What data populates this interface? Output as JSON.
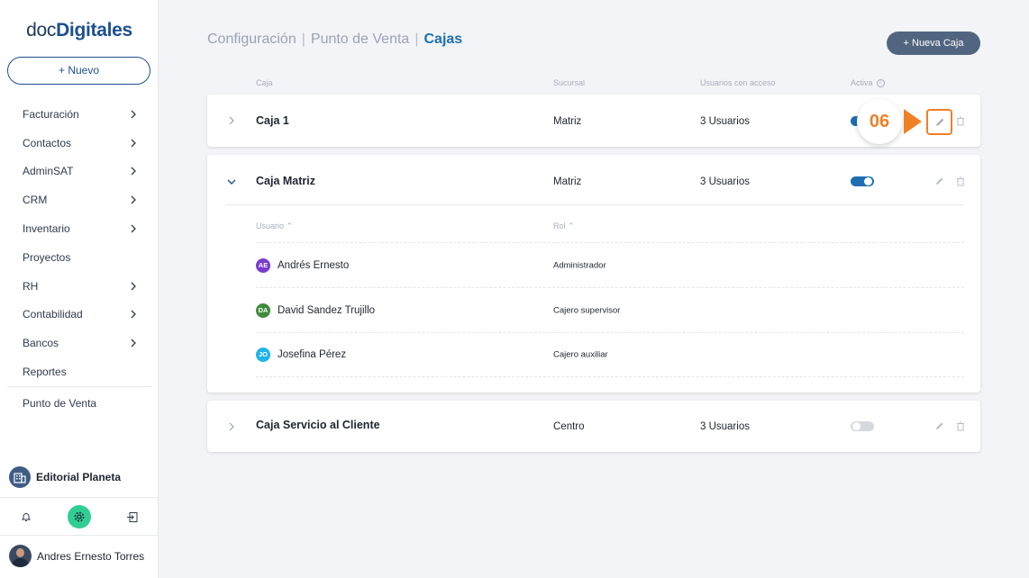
{
  "brand": {
    "logo_prefix": "doc",
    "logo_bold": "Digitales"
  },
  "sidebar": {
    "new_button": "+ Nuevo",
    "items": [
      {
        "label": "Facturación"
      },
      {
        "label": "Contactos"
      },
      {
        "label": "AdminSAT"
      },
      {
        "label": "CRM"
      },
      {
        "label": "Inventario"
      },
      {
        "label": "Proyectos"
      },
      {
        "label": "RH"
      },
      {
        "label": "Contabilidad"
      },
      {
        "label": "Bancos"
      },
      {
        "label": "Reportes"
      }
    ],
    "punto_venta": "Punto de Venta",
    "company": "Editorial Planeta",
    "user": "Andres Ernesto Torres",
    "icons": [
      "bell-icon",
      "gear-icon",
      "logout-icon"
    ],
    "gear_color": "#2fcf94"
  },
  "breadcrumb": {
    "part1": "Configuración",
    "part2": "Punto de Venta",
    "current": "Cajas",
    "separator": "|"
  },
  "nueva_caja_button": "+ Nueva Caja",
  "table": {
    "headers": {
      "caja": "Caja",
      "sucursal": "Sucursal",
      "usuarios": "Usuarios con acceso",
      "activa": "Activa"
    },
    "rows": [
      {
        "name": "Caja 1",
        "sucursal": "Matriz",
        "usuarios": "3 Usuarios",
        "active": true
      },
      {
        "name": "Caja Matriz",
        "sucursal": "Matriz",
        "usuarios": "3 Usuarios",
        "active": true,
        "expanded": true,
        "sub_headers": {
          "usuario": "Usuario ⌃",
          "rol": "Rol ⌃"
        },
        "members": [
          {
            "initials": "AE",
            "name": "Andrés Ernesto",
            "role": "Administrador",
            "color": "#7a3bd1"
          },
          {
            "initials": "DA",
            "name": "David Sandez Trujillo",
            "role": "Cajero supervisor",
            "color": "#3d8b3d"
          },
          {
            "initials": "JO",
            "name": "Josefina Pérez",
            "role": "Cajero auxiliar",
            "color": "#1fb3e8"
          }
        ]
      },
      {
        "name": "Caja Servicio al Cliente",
        "sucursal": "Centro",
        "usuarios": "3 Usuarios",
        "active": false
      }
    ]
  },
  "annotation": {
    "step": "06",
    "color": "#f08026"
  },
  "colors": {
    "accent": "#1d6fb3",
    "brand_dark": "#1d4f91",
    "button_bg": "#516580"
  }
}
